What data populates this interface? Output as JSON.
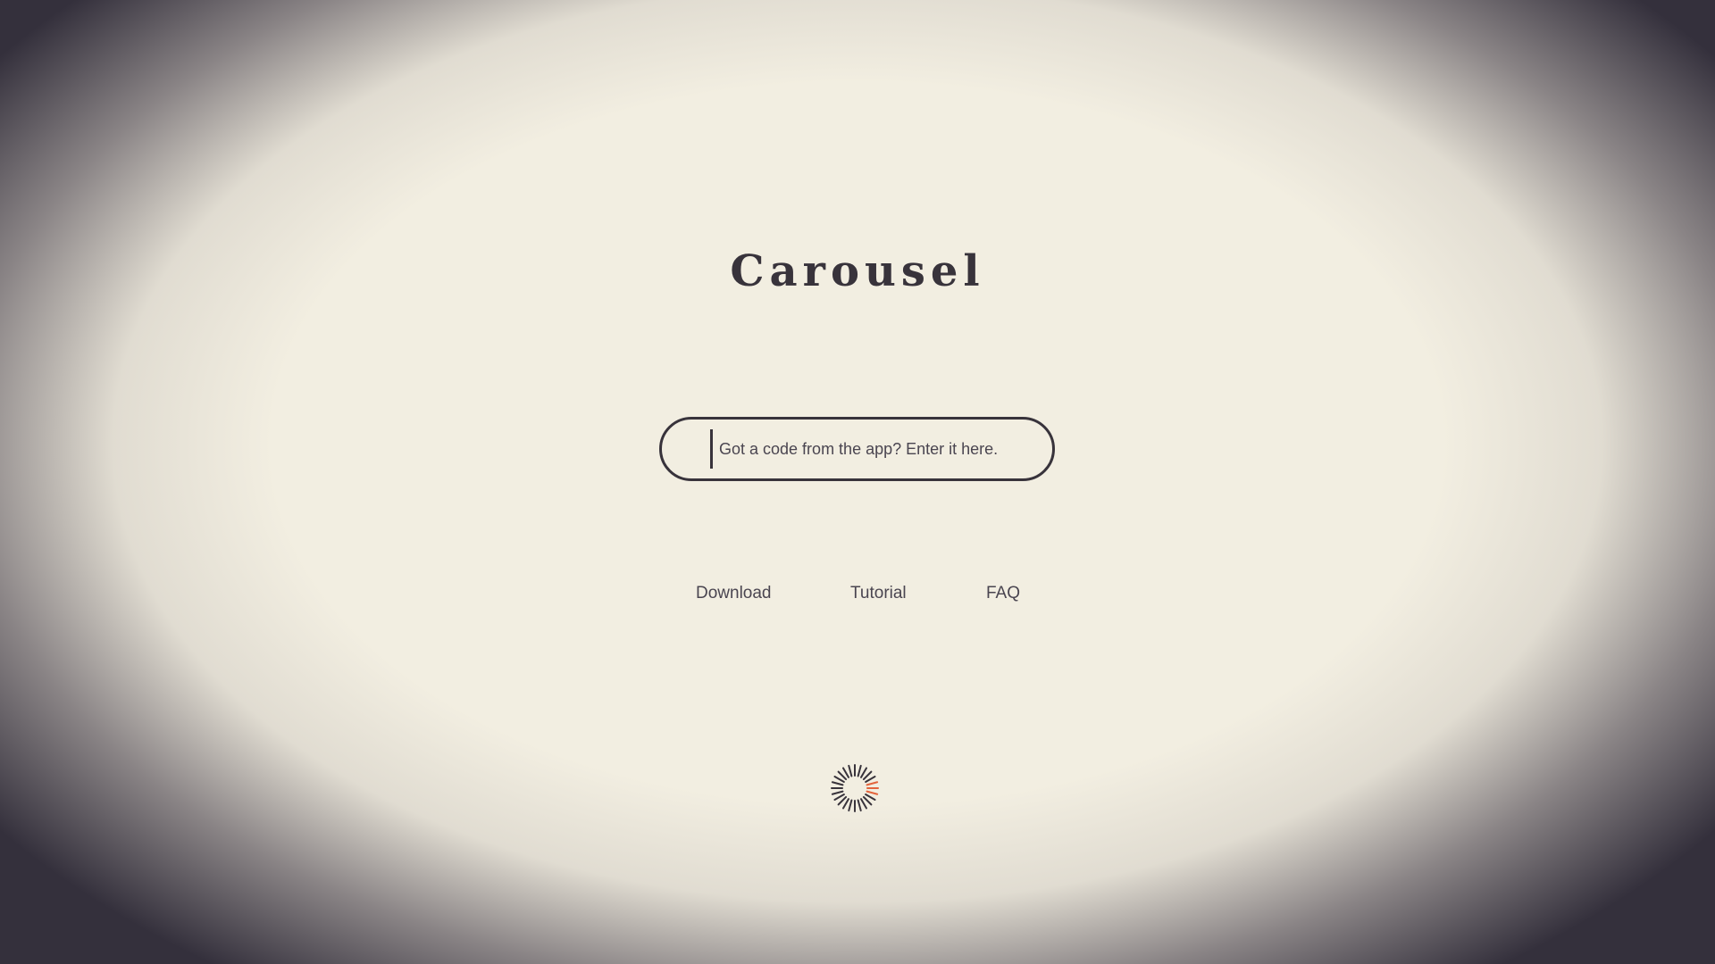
{
  "app": {
    "title": "Carousel"
  },
  "code_entry": {
    "placeholder": "Got a code from the app? Enter it here.",
    "value": ""
  },
  "nav": {
    "items": [
      {
        "label": "Download"
      },
      {
        "label": "Tutorial"
      },
      {
        "label": "FAQ"
      }
    ]
  },
  "loading_indicator": {
    "icon": "loading-spinner-icon"
  },
  "colors": {
    "background": "#f2eee1",
    "text_dark": "#38333b",
    "text_muted": "#4a4550",
    "vignette_edge": "#34303c",
    "spinner_accent": "#e3643c"
  }
}
